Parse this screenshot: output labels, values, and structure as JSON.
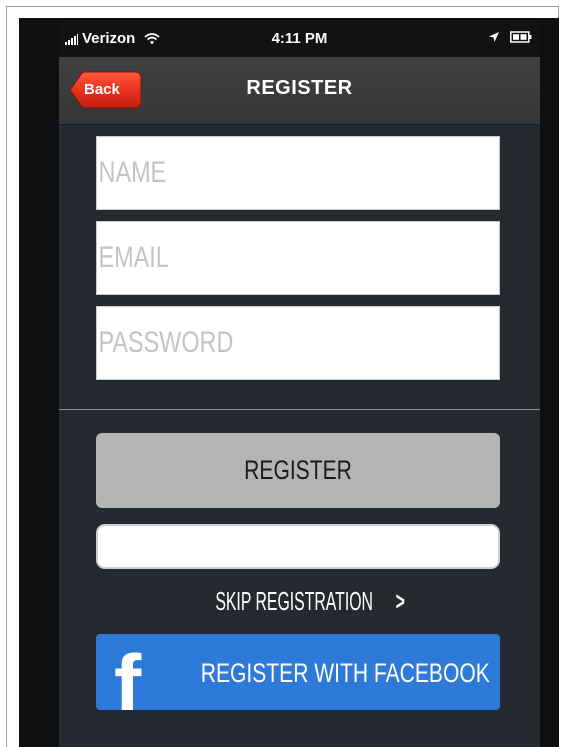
{
  "status_bar": {
    "carrier": "Verizon",
    "time": "4:11 PM",
    "icons": [
      "signal-icon",
      "wifi-icon",
      "location-arrow-icon",
      "battery-icon"
    ]
  },
  "nav": {
    "back_label": "Back",
    "title": "REGISTER"
  },
  "form": {
    "name_placeholder": "NAME",
    "name_value": "",
    "email_placeholder": "EMAIL",
    "email_value": "",
    "password_placeholder": "PASSWORD",
    "password_value": ""
  },
  "actions": {
    "register_label": "REGISTER",
    "skip_label": "SKIP REGISTRATION",
    "skip_chevron": ">",
    "facebook_label": "REGISTER WITH FACEBOOK",
    "facebook_icon_glyph": "f"
  },
  "colors": {
    "screen_background": "#252a31",
    "back_button": "#e8321f",
    "register_button": "#b4b4b4",
    "facebook_button": "#2d7ad8"
  }
}
